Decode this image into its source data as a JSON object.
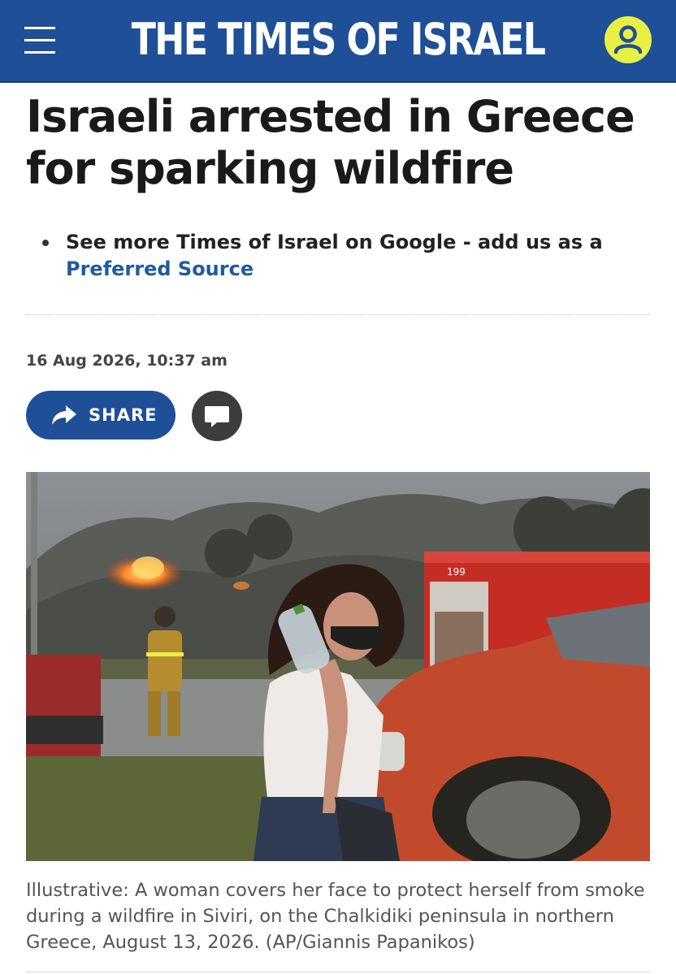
{
  "header": {
    "logo_text": "THE TIMES OF ISRAEL",
    "menu_icon": "hamburger-menu-icon",
    "user_icon": "user-account-icon",
    "brand_color": "#1e4f97",
    "accent_color": "#e8f043"
  },
  "article": {
    "headline": "Israeli arrested in Greece for sparking wildfire",
    "promo_text": "See more Times of Israel on Google - add us as a",
    "promo_link": "Preferred Source",
    "date": "16 Aug 2026, 10:37 am",
    "share_label": "SHARE",
    "share_icon": "share-arrow-icon",
    "comment_icon": "comment-bubble-icon",
    "photo_alt": "Woman covers her face from wildfire smoke beside a red fire truck",
    "photo_truck_label": "199",
    "caption": "Illustrative: A woman covers her face to protect herself from smoke during a wildfire in Siviri, on the Chalkidiki peninsula in northern Greece, August 13, 2026. (AP/Giannis Papanikos)"
  }
}
